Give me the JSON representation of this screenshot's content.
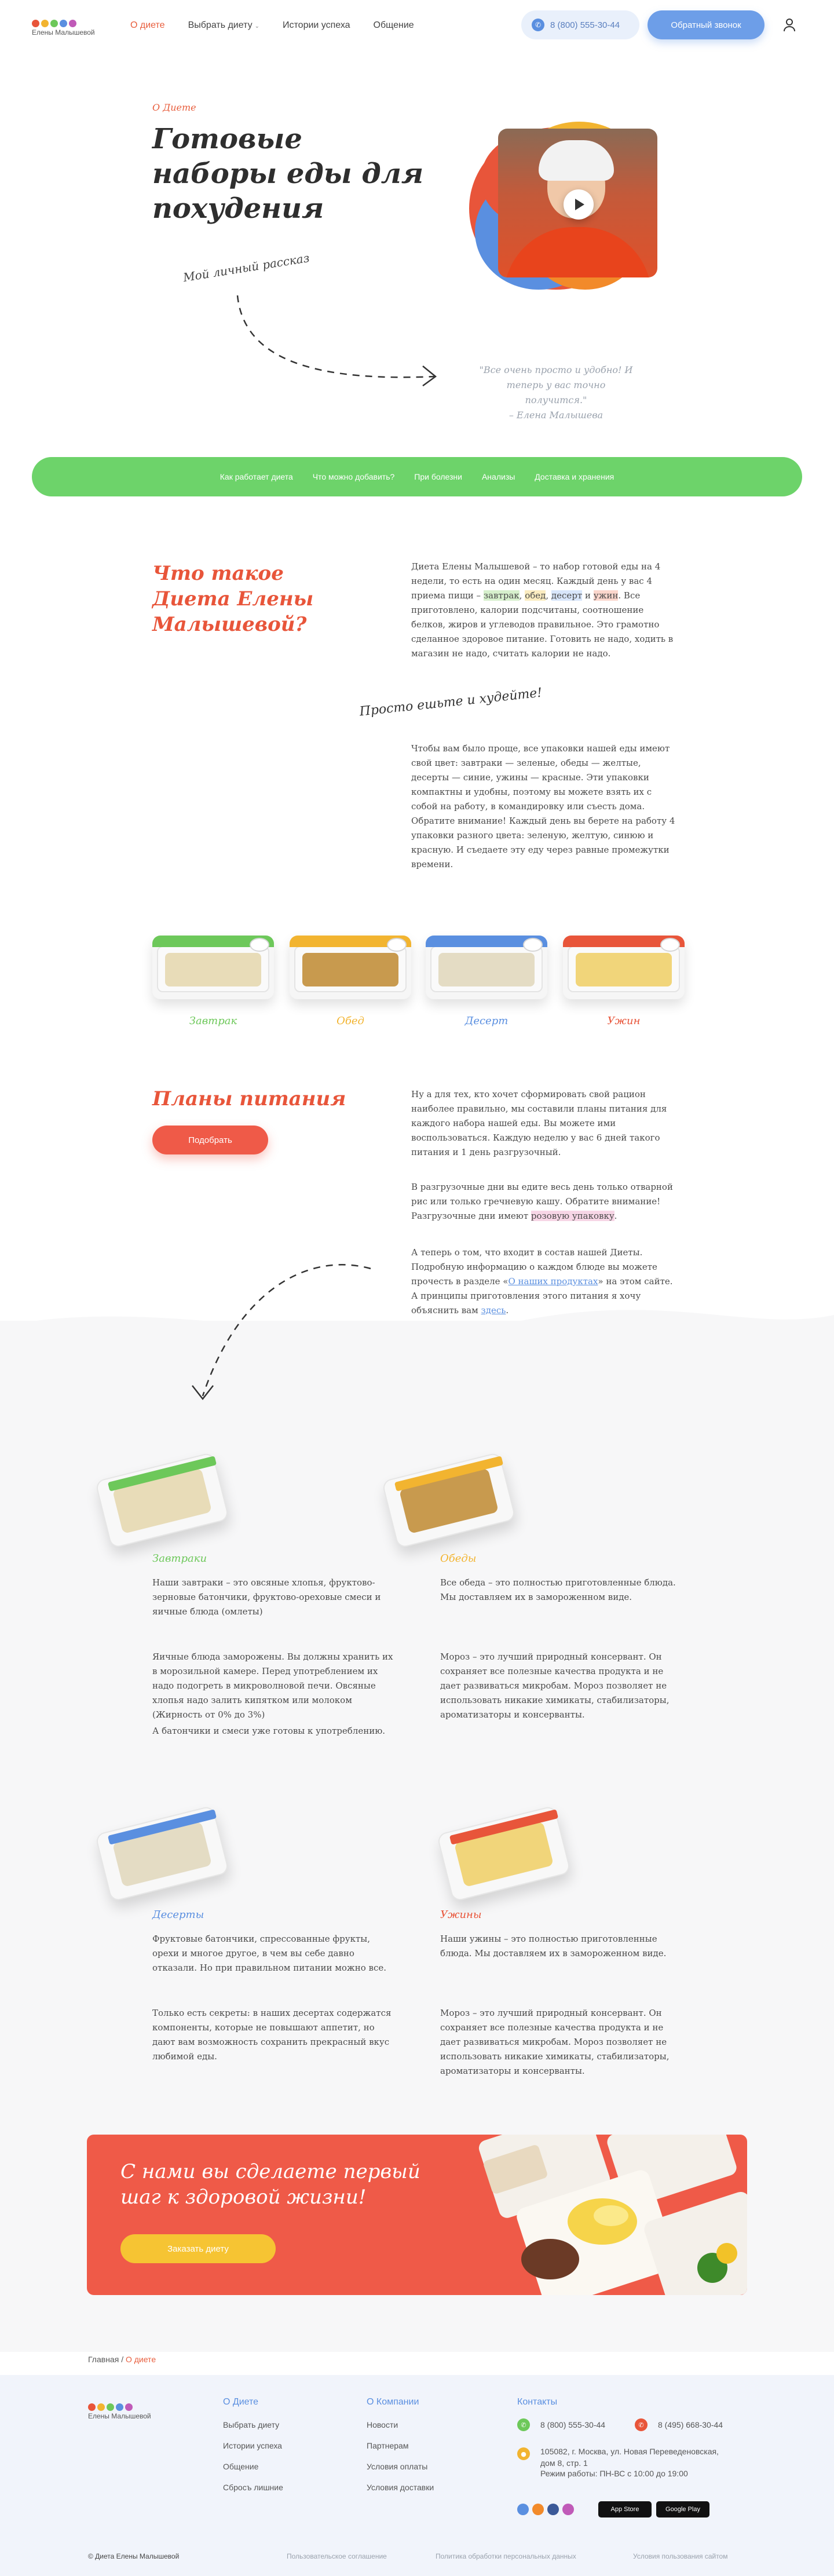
{
  "brand": {
    "name": "Елены Малышевой",
    "colors": {
      "accent_red": "#e85d3c",
      "green": "#6dd36a",
      "blue": "#6d9ee8",
      "yellow": "#f6c433"
    }
  },
  "nav": {
    "items": [
      {
        "label": "О диете",
        "active": true
      },
      {
        "label": "Выбрать диету",
        "dropdown": true
      },
      {
        "label": "Истории успеха"
      },
      {
        "label": "Общение"
      }
    ],
    "phone": "8 (800) 555-30-44",
    "callback_label": "Обратный звонок",
    "icons": {
      "phone": "phone-icon",
      "user": "user-icon",
      "chevron": "chevron-down-icon"
    }
  },
  "hero": {
    "eyebrow": "О Диете",
    "title": "Готовые наборы еды для похудения",
    "story_label": "Мой личный рассказ",
    "quote": "\"Все очень просто и удобно! И теперь у вас точно получится.\"",
    "quote_author": "– Елена Малышева"
  },
  "tabs": [
    "Как работает диета",
    "Что можно добавить?",
    "При болезни",
    "Анализы",
    "Доставка и хранения"
  ],
  "about": {
    "title": "Что такое Диета Елены Малышевой?",
    "p1_before": "Диета Елены Малышевой – то набор готовой еды на 4 недели, то есть на один месяц. Каждый день у вас 4 приема пищи –",
    "p1_breakfast": "завтрак",
    "p1_lunch": "обед",
    "p1_dessert": "десерт",
    "p1_dinner": "ужин",
    "p1_after": ". Все приготовлено, калории подсчитаны, соотношение белков, жиров и углеводов правильное. Это грамотно сделанное здоровое питание. Готовить не надо, ходить в магазин не надо, считать калории не надо.",
    "handwritten": "Просто ешьте и худейте!",
    "p2": "Чтобы вам было проще, все упаковки нашей еды имеют свой цвет: завтраки — зеленые, обеды — желтые, десерты — синие, ужины — красные. Эти упаковки компактны и удобны, поэтому вы можете взять их с собой на работу, в командировку или съесть дома. Обратите внимание! Каждый день вы берете на работу 4 упаковки разного цвета: зеленую, желтую, синюю и красную. И съедаете эту еду через равные промежутки времени."
  },
  "meals": [
    {
      "name": "Завтрак",
      "color": "#6dc85a"
    },
    {
      "name": "Обед",
      "color": "#f2b430"
    },
    {
      "name": "Десерт",
      "color": "#5a8fe0"
    },
    {
      "name": "Ужин",
      "color": "#e8553a"
    }
  ],
  "plans": {
    "title": "Планы питания",
    "button": "Подобрать",
    "p1": "Ну а для тех, кто хочет сформировать свой рацион наиболее правильно, мы составили планы питания для каждого набора нашей еды. Вы можете ими воспользоваться. Каждую неделю у вас 6 дней такого питания и 1 день разгрузочный.",
    "p2_before": "В разгрузочные дни вы едите весь день только отварной рис или только гречневую кашу. Обратите внимание! Разгрузочные дни имеют",
    "p2_highlight": "розовую упаковку",
    "p2_after": ".",
    "p3_before": "А теперь о том, что входит в состав нашей Диеты. Подробную информацию о каждом блюде вы можете прочесть в разделе «",
    "p3_link": "О наших продуктах",
    "p3_mid": "» на этом сайте. А принципы приготовления этого питания я хочу объяснить вам",
    "p3_link2": "здесь",
    "p3_after": "."
  },
  "categories": [
    {
      "title": "Завтраки",
      "color": "#6dc85a",
      "p1": "Наши завтраки – это овсяные хлопья, фруктово-зерновые батончики, фруктово-ореховые смеси и яичные блюда (омлеты)",
      "p2": "Яичные блюда заморожены. Вы должны хранить их в морозильной камере. Перед употреблением их надо подогреть в микроволновой печи. Овсяные хлопья надо залить кипятком или молоком (Жирность от 0% до 3%)",
      "p3": "А батончики и смеси уже готовы к употреблению."
    },
    {
      "title": "Обеды",
      "color": "#f2b430",
      "p1": "Все обеда – это полностью приготовленные блюда. Мы доставляем их в замороженном виде.",
      "p2": "Мороз – это лучший природный консервант. Он сохраняет все полезные качества продукта и не дает развиваться микробам. Мороз позволяет не использовать никакие химикаты, стабилизаторы, ароматизаторы и консерванты.",
      "p3": ""
    },
    {
      "title": "Десерты",
      "color": "#5a8fe0",
      "p1": "Фруктовые батончики, спрессованные фрукты, орехи и многое другое, в чем вы себе давно отказали. Но при правильном питании можно все.",
      "p2": "Только есть секреты: в наших десертах содержатся компоненты, которые не повышают аппетит, но дают вам возможность сохранить прекрасный вкус любимой еды.",
      "p3": ""
    },
    {
      "title": "Ужины",
      "color": "#e8553a",
      "p1": "Наши ужины – это полностью приготовленные блюда. Мы доставляем их в замороженном виде.",
      "p2": "Мороз – это лучший природный консервант. Он сохраняет все полезные качества продукта и не дает развиваться микробам. Мороз позволяет не использовать никакие химикаты, стабилизаторы, ароматизаторы и консерванты.",
      "p3": ""
    }
  ],
  "promo": {
    "title": "С нами вы сделаете первый шаг к здоровой жизни!",
    "button": "Заказать диету"
  },
  "breadcrumb": {
    "home": "Главная",
    "current": "О диете",
    "sep": "/"
  },
  "footer": {
    "col1_title": "О Диете",
    "col1": [
      "Выбрать диету",
      "Истории успеха",
      "Общение",
      "Сбросъ лишние"
    ],
    "col2_title": "О Компании",
    "col2": [
      "Новости",
      "Партнерам",
      "Условия оплаты",
      "Условия доставки"
    ],
    "contacts_title": "Контакты",
    "phone1": "8 (800) 555-30-44",
    "phone2": "8 (495) 668-30-44",
    "address": "105082, г. Москва, ул. Новая Переведеновская, дом 8, стр. 1",
    "hours": "Режим работы: ПН-ВС с 10:00 до 19:00",
    "app_store": "App Store",
    "google_play": "Google Play",
    "copyright": "© Диета Елены Малышевой",
    "links": [
      "Пользовательское соглашение",
      "Политика обработки персональных данных",
      "Условия пользования сайтом"
    ]
  }
}
